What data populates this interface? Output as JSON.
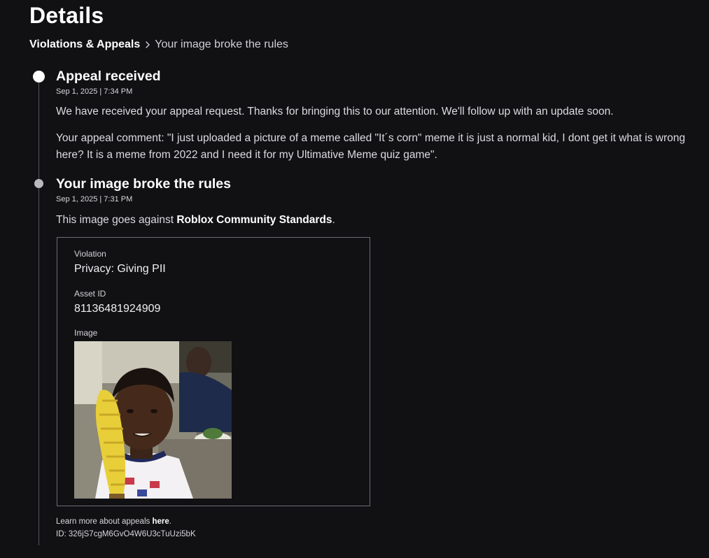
{
  "page": {
    "title": "Details"
  },
  "breadcrumb": {
    "parent": "Violations & Appeals",
    "current": "Your image broke the rules"
  },
  "timeline": {
    "appeal": {
      "title": "Appeal received",
      "timestamp": "Sep 1, 2025 | 7:34 PM",
      "message": "We have received your appeal request. Thanks for bringing this to our attention. We'll follow up with an update soon.",
      "comment": "Your appeal comment: \"I just uploaded a picture of a meme called \"It´s corn\" meme it is just a normal kid, I dont get it what is wrong here? It is a meme from 2022 and I need it for my Ultimative Meme quiz game\"."
    },
    "violation": {
      "title": "Your image broke the rules",
      "timestamp": "Sep 1, 2025 | 7:31 PM",
      "message_prefix": "This image goes against ",
      "message_link": "Roblox Community Standards",
      "message_suffix": "."
    }
  },
  "violation_card": {
    "violation_label": "Violation",
    "violation_value": "Privacy: Giving PII",
    "asset_label": "Asset ID",
    "asset_value": "81136481924909",
    "image_label": "Image"
  },
  "footer": {
    "learn_prefix": "Learn more about appeals ",
    "learn_link": "here",
    "learn_suffix": ".",
    "id_text": "ID: 326jS7cgM6GvO4W6U3cTuUzi5bK"
  },
  "colors": {
    "background": "#111114",
    "text_primary": "#ffffff",
    "card_border": "#6d6d73",
    "timeline_line": "#56565c"
  },
  "icons": {
    "breadcrumb_separator": "chevron-right-icon"
  }
}
